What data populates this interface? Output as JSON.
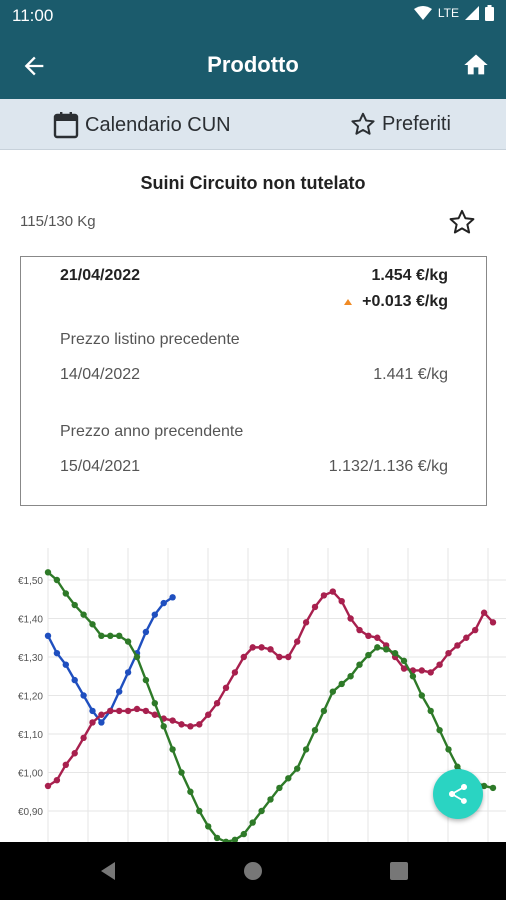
{
  "status": {
    "time": "11:00",
    "network": "LTE"
  },
  "app_bar": {
    "title": "Prodotto"
  },
  "sub_bar": {
    "calendar_label": "Calendario CUN",
    "favorites_label": "Preferiti"
  },
  "product": {
    "name": "Suini Circuito non tutelato",
    "weight": "115/130 Kg"
  },
  "card": {
    "date": "21/04/2022",
    "price": "1.454 €/kg",
    "delta": "+0.013 €/kg",
    "prev_label": "Prezzo listino precedente",
    "prev_date": "14/04/2022",
    "prev_price": "1.441 €/kg",
    "year_label": "Prezzo anno precendente",
    "year_date": "15/04/2021",
    "year_price": "1.132/1.136 €/kg"
  },
  "colors": {
    "primary": "#1b5b6c",
    "subbar": "#dde6ee",
    "fab": "#2ad4c2",
    "up_arrow": "#f08a24"
  },
  "icons": {
    "back": "arrow-left-icon",
    "home": "home-icon",
    "calendar": "calendar-icon",
    "favorites": "star-outline-icon",
    "share": "share-icon"
  },
  "chart_data": {
    "type": "line",
    "ylim": [
      0.85,
      1.55
    ],
    "y_ticks": [
      "€1,50",
      "€1,40",
      "€1,30",
      "€1,20",
      "€1,10",
      "€1,00",
      "€0,90"
    ],
    "series": [
      {
        "color": "#1f4fbf",
        "values": [
          1.355,
          1.31,
          1.28,
          1.24,
          1.2,
          1.16,
          1.13,
          1.16,
          1.21,
          1.26,
          1.31,
          1.365,
          1.41,
          1.44,
          1.455
        ]
      },
      {
        "color": "#a8204e",
        "values": [
          0.965,
          0.98,
          1.02,
          1.05,
          1.09,
          1.13,
          1.15,
          1.16,
          1.16,
          1.16,
          1.165,
          1.16,
          1.15,
          1.14,
          1.135,
          1.125,
          1.12,
          1.125,
          1.15,
          1.18,
          1.22,
          1.26,
          1.3,
          1.325,
          1.325,
          1.32,
          1.3,
          1.3,
          1.34,
          1.39,
          1.43,
          1.46,
          1.47,
          1.445,
          1.4,
          1.37,
          1.355,
          1.35,
          1.33,
          1.3,
          1.27,
          1.265,
          1.265,
          1.26,
          1.28,
          1.31,
          1.33,
          1.35,
          1.37,
          1.415,
          1.39
        ]
      },
      {
        "color": "#2e7a28",
        "values": [
          1.52,
          1.5,
          1.465,
          1.435,
          1.41,
          1.385,
          1.355,
          1.355,
          1.355,
          1.34,
          1.3,
          1.24,
          1.18,
          1.12,
          1.06,
          1.0,
          0.95,
          0.9,
          0.86,
          0.83,
          0.82,
          0.825,
          0.84,
          0.87,
          0.9,
          0.93,
          0.96,
          0.985,
          1.01,
          1.06,
          1.11,
          1.16,
          1.21,
          1.23,
          1.25,
          1.28,
          1.305,
          1.325,
          1.32,
          1.31,
          1.29,
          1.25,
          1.2,
          1.16,
          1.11,
          1.06,
          1.015,
          0.99,
          0.975,
          0.965,
          0.96
        ]
      }
    ]
  }
}
